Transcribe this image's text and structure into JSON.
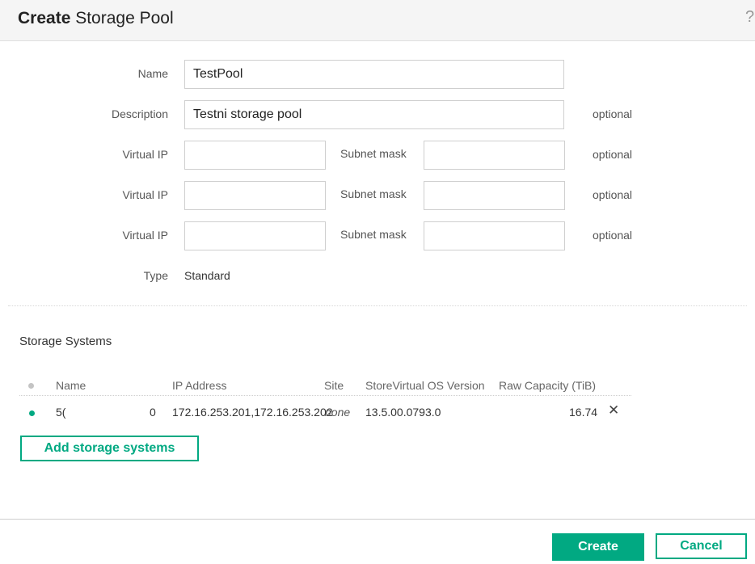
{
  "header": {
    "title_bold": "Create",
    "title_rest": " Storage Pool",
    "help": "?"
  },
  "form": {
    "name_label": "Name",
    "name_value": "TestPool",
    "description_label": "Description",
    "description_value": "Testni storage pool",
    "optional": "optional",
    "virtual_ip_label": "Virtual IP",
    "subnet_mask_label": "Subnet mask",
    "vip_rows": [
      {
        "virtual_ip": "",
        "subnet_mask": ""
      },
      {
        "virtual_ip": "",
        "subnet_mask": ""
      },
      {
        "virtual_ip": "",
        "subnet_mask": ""
      }
    ],
    "type_label": "Type",
    "type_value": "Standard"
  },
  "storage": {
    "section_title": "Storage Systems",
    "columns": {
      "name": "Name",
      "ip": "IP Address",
      "site": "Site",
      "version": "StoreVirtual OS Version",
      "capacity": "Raw Capacity (TiB)"
    },
    "rows": [
      {
        "status_color": "#01a982",
        "name_a": "5(",
        "name_b": "0",
        "ip": "172.16.253.201,172.16.253.202",
        "site": "none",
        "version": "13.5.00.0793.0",
        "capacity": "16.74",
        "remove": "✕"
      }
    ],
    "add_button": "Add storage systems"
  },
  "footer": {
    "create": "Create",
    "cancel": "Cancel"
  },
  "colors": {
    "accent": "#01a982"
  },
  "icons": {
    "help": "help-icon",
    "remove": "close-icon",
    "status": "status-dot-icon"
  }
}
